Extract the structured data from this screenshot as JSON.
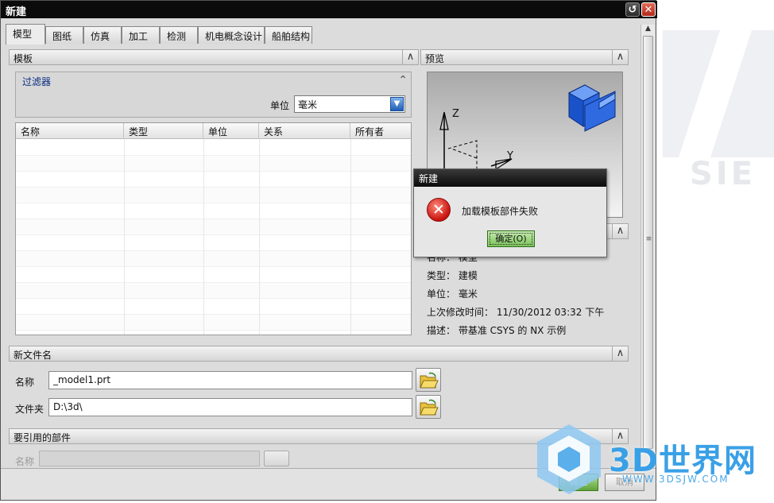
{
  "window": {
    "title": "新建"
  },
  "tabs": [
    "模型",
    "图纸",
    "仿真",
    "加工",
    "检测",
    "机电概念设计",
    "船舶结构"
  ],
  "template_section": {
    "title": "模板"
  },
  "filter": {
    "title": "过滤器",
    "unit_label": "单位",
    "unit_value": "毫米"
  },
  "table": {
    "columns": [
      "名称",
      "类型",
      "单位",
      "关系",
      "所有者"
    ]
  },
  "preview_section": {
    "title": "预览",
    "axis_z": "Z",
    "axis_y": "Y"
  },
  "properties": {
    "name_line": "名称：  模型",
    "type_line": "类型：  建模",
    "unit_line": "单位：  毫米",
    "modified_line": "上次修改时间：  11/30/2012 03:32 下午",
    "desc_line": "描述：  带基准 CSYS 的 NX 示例"
  },
  "new_file_section": {
    "title": "新文件名",
    "name_label": "名称",
    "name_value": "_model1.prt",
    "folder_label": "文件夹",
    "folder_value": "D:\\3d\\"
  },
  "ref_parts_section": {
    "title": "要引用的部件",
    "name_label": "名称"
  },
  "bottom": {
    "ok_label": "确定",
    "cancel_label": "取消"
  },
  "error_dialog": {
    "title": "新建",
    "message": "加载模板部件失败",
    "ok_label": "确定(O)"
  },
  "watermark": {
    "brand": "3D世界网",
    "url": "WWW.3DSJW.COM"
  },
  "background_app": {
    "partial_text": "SIE"
  }
}
